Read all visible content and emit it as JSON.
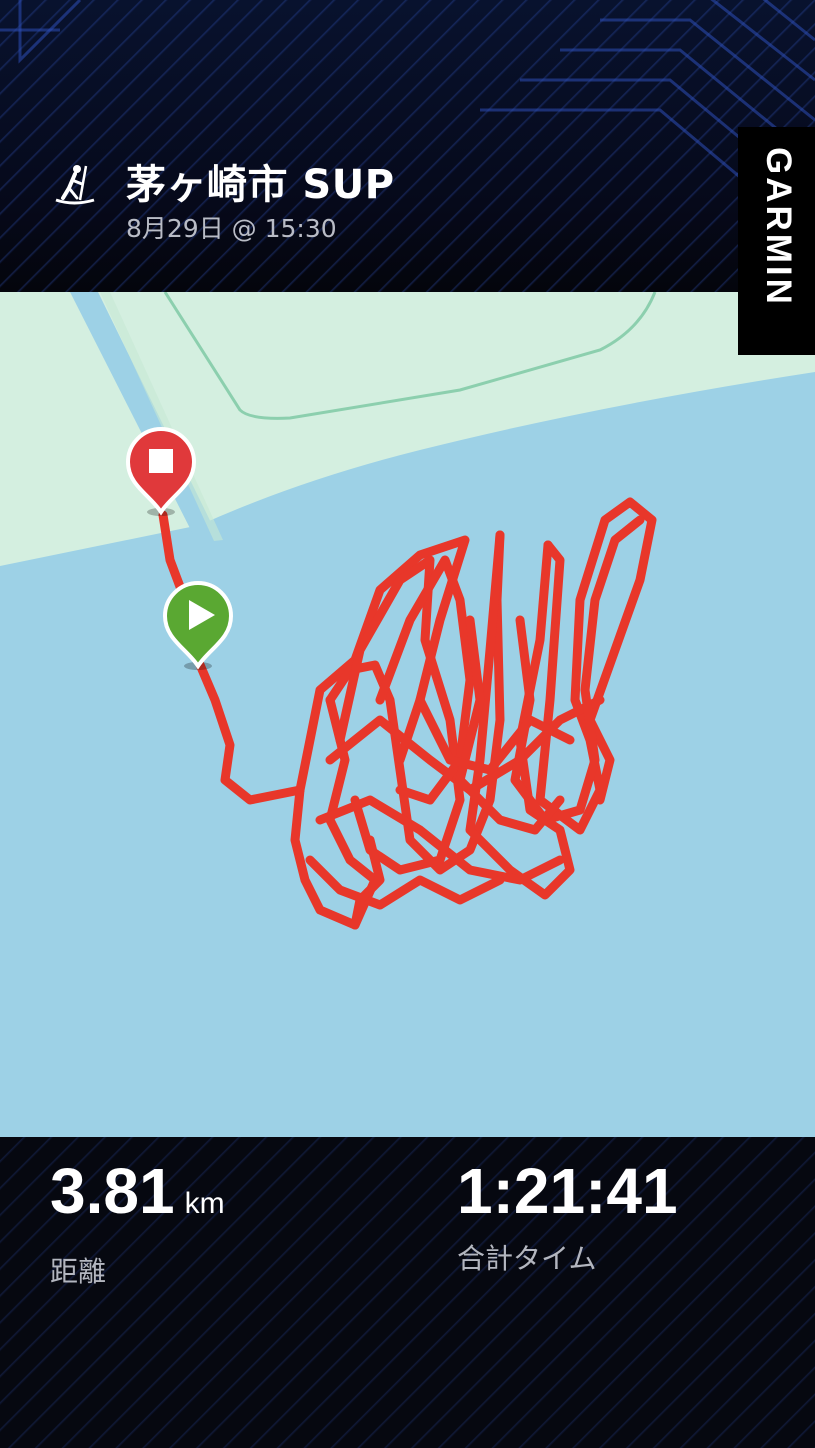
{
  "header": {
    "title": "茅ヶ崎市 SUP",
    "subtitle": "8月29日 @ 15:30",
    "activity_icon": "paddleboard-icon"
  },
  "brand": {
    "name": "GARMIN"
  },
  "map": {
    "start_marker_icon": "play-icon",
    "end_marker_icon": "stop-icon",
    "colors": {
      "water": "#9dd1e6",
      "land": "#d4efe0",
      "route": "#e8372a",
      "start": "#5aa832",
      "end": "#e0393b"
    }
  },
  "stats": {
    "distance": {
      "value": "3.81",
      "unit": "km",
      "label": "距離"
    },
    "total_time": {
      "value": "1:21:41",
      "label": "合計タイム"
    }
  }
}
